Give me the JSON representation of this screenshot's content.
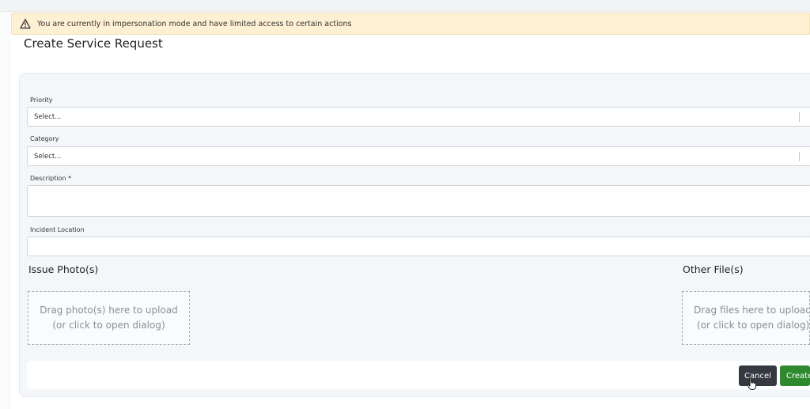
{
  "alert": {
    "icon": "warning-triangle-icon",
    "text": "You are currently in impersonation mode and have limited access to certain actions"
  },
  "page": {
    "title": "Create Service Request"
  },
  "form": {
    "priority": {
      "label": "Priority",
      "value": "Select..."
    },
    "category": {
      "label": "Category",
      "value": "Select..."
    },
    "description": {
      "label": "Description *",
      "value": ""
    },
    "incident_location": {
      "label": "Incident Location",
      "value": ""
    },
    "issue_photos": {
      "heading": "Issue Photo(s)",
      "drop_line1": "Drag photo(s) here to upload",
      "drop_line2": "(or click to open dialog)"
    },
    "other_files": {
      "heading": "Other File(s)",
      "drop_line1": "Drag files here to upload",
      "drop_line2": "(or click to open dialog)"
    }
  },
  "actions": {
    "cancel_label": "Cancel",
    "create_label": "Create"
  },
  "colors": {
    "alert_bg": "#fdf0d3",
    "cancel_bg": "#343a40",
    "create_bg": "#2f8a2f"
  }
}
